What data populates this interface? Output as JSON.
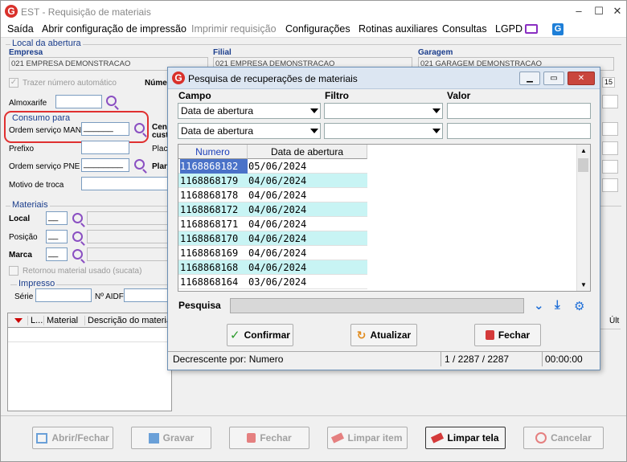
{
  "window": {
    "title": "EST - Requisição de materiais",
    "minimize": "–",
    "maximize": "☐",
    "close": "✕"
  },
  "menu": [
    "Saída",
    "Abrir configuração de impressão",
    "Imprimir requisição",
    "Configurações",
    "Rotinas auxiliares",
    "Consultas",
    "LGPD"
  ],
  "local_abertura": {
    "group": "Local da abertura",
    "empresa_label": "Empresa",
    "empresa_value": "021 EMPRESA DEMONSTRACAO",
    "filial_label": "Filial",
    "filial_value": "021 EMPRESA DEMONSTRACAO",
    "garagem_label": "Garagem",
    "garagem_value": "021 GARAGEM DEMONSTRACAO",
    "trazer_numero": "Trazer número automático",
    "numero_label": "Númer",
    "almoxarife_label": "Almoxarife"
  },
  "consumo": {
    "group": "Consumo para",
    "ordem_man_label": "Ordem serviço MAN",
    "ordem_man_value": "______",
    "prefixo_label": "Prefixo",
    "ordem_pne_label": "Ordem serviço PNE",
    "ordem_pne_value": "________",
    "motivo_label": "Motivo de troca",
    "cen_label": "Cen",
    "cus_label": "cust",
    "placa_label": "Placa",
    "plan_label": "Plan"
  },
  "materiais": {
    "group": "Materiais",
    "local_label": "Local",
    "local_value": "__",
    "posicao_label": "Posição",
    "posicao_value": "__",
    "marca_label": "Marca",
    "marca_value": "__",
    "retornou": "Retornou material usado (sucata)",
    "impresso_group": "Impresso",
    "serie_label": "Série",
    "aidf_label": "Nº AIDF",
    "table_headers": [
      "L...",
      "Material",
      "Descrição do material"
    ],
    "right_header": "Últ"
  },
  "dialog": {
    "title": "Pesquisa de recuperações de materiais",
    "campo_label": "Campo",
    "filtro_label": "Filtro",
    "valor_label": "Valor",
    "campo1": "Data de abertura",
    "campo2": "Data de abertura",
    "grid_headers": [
      "Numero",
      "Data de abertura"
    ],
    "rows": [
      {
        "numero": "1168868182",
        "data": "05/06/2024"
      },
      {
        "numero": "1168868179",
        "data": "04/06/2024"
      },
      {
        "numero": "1168868178",
        "data": "04/06/2024"
      },
      {
        "numero": "1168868172",
        "data": "04/06/2024"
      },
      {
        "numero": "1168868171",
        "data": "04/06/2024"
      },
      {
        "numero": "1168868170",
        "data": "04/06/2024"
      },
      {
        "numero": "1168868169",
        "data": "04/06/2024"
      },
      {
        "numero": "1168868168",
        "data": "04/06/2024"
      },
      {
        "numero": "1168868164",
        "data": "03/06/2024"
      }
    ],
    "pesquisa_label": "Pesquisa",
    "btn_confirmar": "Confirmar",
    "btn_atualizar": "Atualizar",
    "btn_fechar": "Fechar",
    "status_order": "Decrescente por: Numero",
    "status_count": "1 / 2287 / 2287",
    "status_time": "00:00:00"
  },
  "bottom_buttons": [
    "Abrir/Fechar",
    "Gravar",
    "Fechar",
    "Limpar item",
    "Limpar tela",
    "Cancelar"
  ],
  "colors": {
    "accent_red": "#d9312b",
    "label_blue": "#1a3d8c",
    "row_cyan": "#c8f4f4",
    "selection_blue": "#4a72c8"
  }
}
